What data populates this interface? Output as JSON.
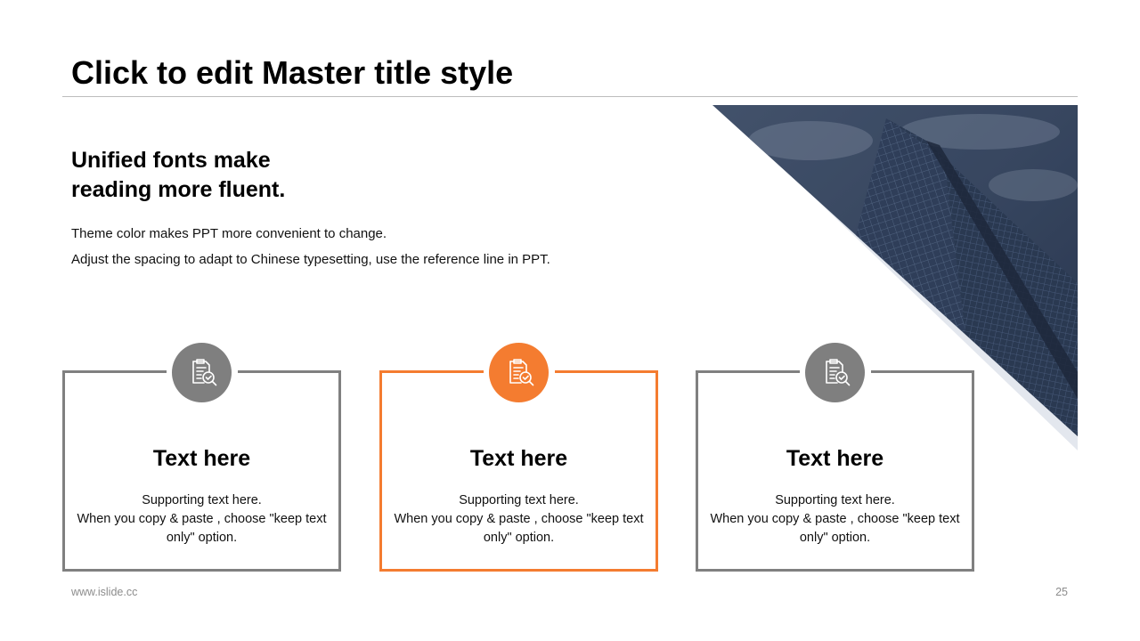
{
  "slide": {
    "title": "Click to edit Master title style",
    "headline_line1": "Unified fonts make",
    "headline_line2": "reading more fluent.",
    "body_line1": "Theme color makes PPT more convenient to change.",
    "body_line2": "Adjust the spacing to adapt to Chinese typesetting, use the reference line in PPT."
  },
  "cards": [
    {
      "title": "Text here",
      "line1": "Supporting  text here.",
      "line2": "When  you copy & paste , choose \"keep text only\" option.",
      "icon": "document-check-search-icon",
      "highlighted": false
    },
    {
      "title": "Text here",
      "line1": "Supporting  text here.",
      "line2": "When  you copy & paste , choose \"keep text only\" option.",
      "icon": "document-check-search-icon",
      "highlighted": true
    },
    {
      "title": "Text here",
      "line1": "Supporting  text here.",
      "line2": "When  you copy & paste , choose \"keep text only\" option.",
      "icon": "document-check-search-icon",
      "highlighted": false
    }
  ],
  "footer": {
    "url": "www.islide.cc",
    "page_number": "25"
  },
  "colors": {
    "accent": "#f47c30",
    "neutral": "#808080",
    "rule": "#bdbdbd"
  }
}
